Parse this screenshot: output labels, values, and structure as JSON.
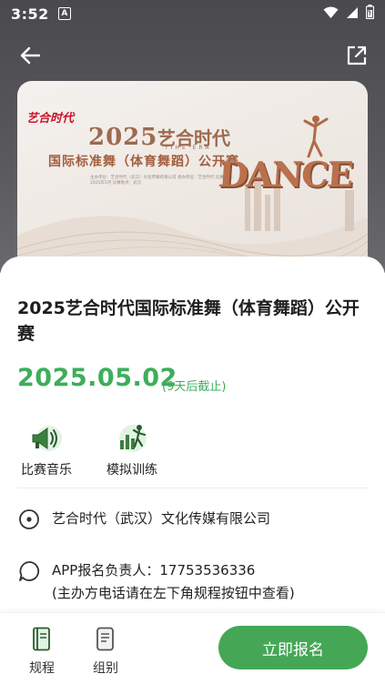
{
  "status_bar": {
    "time": "3:52",
    "notification_badge": "A",
    "icons": [
      "wifi-icon",
      "signal-icon",
      "battery-icon"
    ]
  },
  "nav": {
    "back_icon": "arrow-left-icon",
    "share_icon": "open-external-icon"
  },
  "banner": {
    "logo_text": "艺合时代",
    "year": "2025",
    "brand": "艺合时代",
    "brand_sub": "YIHE ERA",
    "subtitle": "国际标准舞（体育舞蹈）公开赛",
    "small_text": "主办单位：艺合时代（武汉）文化传媒有限公司 承办单位：艺合时代 比赛时间：2025年5月 比赛地点：武汉",
    "dance_word": "DANCE"
  },
  "event": {
    "title": "2025艺合时代国际标准舞（体育舞蹈）公开赛",
    "date": "2025.05.02",
    "deadline": "(9天后截止)"
  },
  "quick_actions": [
    {
      "label": "比赛音乐",
      "icon": "megaphone-icon"
    },
    {
      "label": "模拟训练",
      "icon": "training-chart-icon"
    }
  ],
  "info": {
    "organizer": "艺合时代（武汉）文化传媒有限公司",
    "contact_line1": "APP报名负责人：17753536336",
    "contact_line2": "(主办方电话请在左下角规程按钮中查看)"
  },
  "bottom_bar": {
    "rules_label": "规程",
    "group_label": "组别",
    "signup_label": "立即报名"
  },
  "colors": {
    "accent_green": "#3dae5b",
    "button_green": "#45a756",
    "hero_dark": "#4a4a4d"
  }
}
